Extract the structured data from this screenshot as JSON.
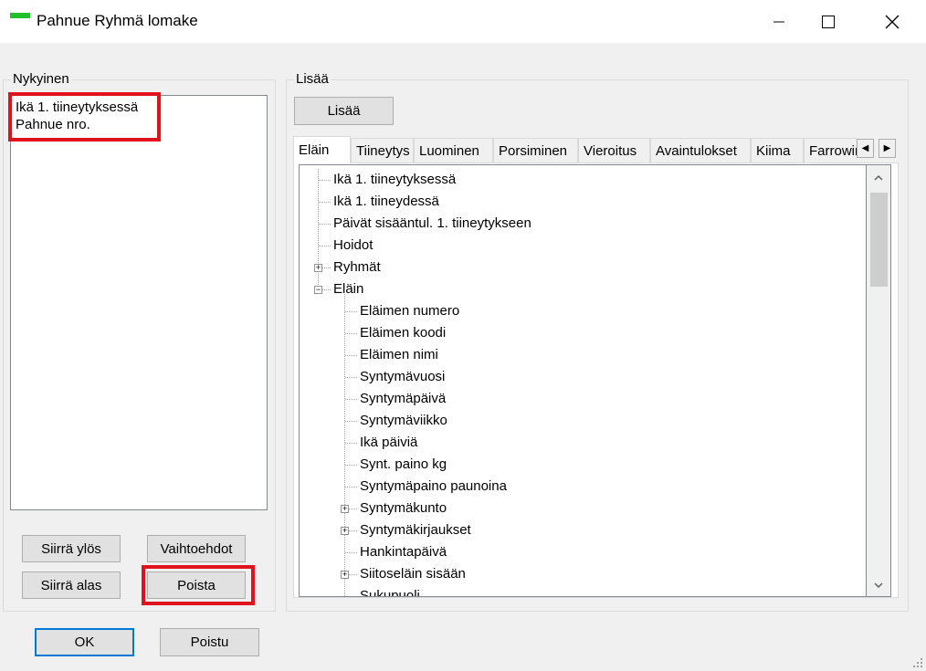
{
  "window": {
    "title": "Pahnue Ryhmä lomake",
    "minimize_label": "Minimize",
    "maximize_label": "Maximize",
    "close_label": "Close"
  },
  "current_group": {
    "label": "Nykyinen",
    "items": [
      "Ikä 1. tiineytyksessä",
      "Pahnue nro."
    ]
  },
  "left_buttons": {
    "move_up": "Siirrä ylös",
    "options": "Vaihtoehdot",
    "move_down": "Siirrä alas",
    "delete": "Poista"
  },
  "add_group": {
    "label": "Lisää",
    "add_button": "Lisää",
    "tabs": [
      "Eläin",
      "Tiineytys",
      "Luominen",
      "Porsiminen",
      "Vieroitus",
      "Avaintulokset",
      "Kiima",
      "Farrowing"
    ],
    "active_tab": "Eläin"
  },
  "tree": [
    {
      "label": "Ikä 1. tiineytyksessä",
      "level": 0,
      "expander": ""
    },
    {
      "label": "Ikä 1. tiineydessä",
      "level": 0,
      "expander": ""
    },
    {
      "label": "Päivät sisääntul. 1. tiineytykseen",
      "level": 0,
      "expander": ""
    },
    {
      "label": "Hoidot",
      "level": 0,
      "expander": ""
    },
    {
      "label": "Ryhmät",
      "level": 0,
      "expander": "+"
    },
    {
      "label": "Eläin",
      "level": 0,
      "expander": "−"
    },
    {
      "label": "Eläimen numero",
      "level": 1,
      "expander": ""
    },
    {
      "label": "Eläimen koodi",
      "level": 1,
      "expander": ""
    },
    {
      "label": "Eläimen nimi",
      "level": 1,
      "expander": ""
    },
    {
      "label": "Syntymävuosi",
      "level": 1,
      "expander": ""
    },
    {
      "label": "Syntymäpäivä",
      "level": 1,
      "expander": ""
    },
    {
      "label": "Syntymäviikko",
      "level": 1,
      "expander": ""
    },
    {
      "label": "Ikä päiviä",
      "level": 1,
      "expander": ""
    },
    {
      "label": "Synt. paino kg",
      "level": 1,
      "expander": ""
    },
    {
      "label": "Syntymäpaino paunoina",
      "level": 1,
      "expander": ""
    },
    {
      "label": "Syntymäkunto",
      "level": 1,
      "expander": "+"
    },
    {
      "label": "Syntymäkirjaukset",
      "level": 1,
      "expander": "+"
    },
    {
      "label": "Hankintapäivä",
      "level": 1,
      "expander": ""
    },
    {
      "label": "Siitoseläin sisään",
      "level": 1,
      "expander": "+"
    },
    {
      "label": "Sukupuoli",
      "level": 1,
      "expander": ""
    }
  ],
  "bottom_buttons": {
    "ok": "OK",
    "exit": "Poistu"
  },
  "colors": {
    "highlight": "#e0121c",
    "default_button_border": "#0078d7",
    "app_icon": "#22c02a"
  }
}
